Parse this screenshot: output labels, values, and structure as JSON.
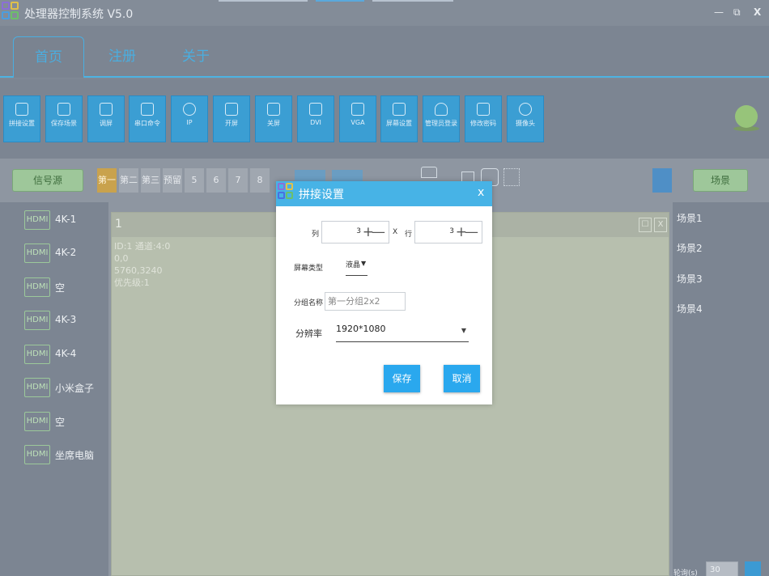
{
  "app": {
    "title": "处理器控制系统 V5.0",
    "window_controls": {
      "minimize": "—",
      "restore": "⧉",
      "close": "X"
    }
  },
  "tabs": [
    {
      "label": "首页",
      "active": true
    },
    {
      "label": "注册",
      "active": false
    },
    {
      "label": "关于",
      "active": false
    }
  ],
  "toolbar": [
    {
      "label": "拼接设置",
      "icon": "monitor-icon"
    },
    {
      "label": "保存场景",
      "icon": "save-icon"
    },
    {
      "label": "调屏",
      "icon": "adjust-icon"
    },
    {
      "label": "串口命令",
      "icon": "serial-icon"
    },
    {
      "label": "IP",
      "icon": "location-icon"
    },
    {
      "label": "开屏",
      "icon": "screen-on-icon"
    },
    {
      "label": "关屏",
      "icon": "screen-off-icon"
    },
    {
      "label": "DVI",
      "icon": "dvi-icon"
    },
    {
      "label": "VGA",
      "icon": "vga-icon"
    },
    {
      "label": "屏幕设置",
      "icon": "screen-settings-icon"
    },
    {
      "label": "管理员登录",
      "icon": "user-icon"
    },
    {
      "label": "修改密码",
      "icon": "lock-icon"
    },
    {
      "label": "摄像头",
      "icon": "camera-icon"
    }
  ],
  "buttonbar": {
    "signal_source": "信号源",
    "scene_button": "场景",
    "pages": [
      "第一",
      "第二",
      "第三",
      "预留",
      "5",
      "6",
      "7",
      "8"
    ],
    "active_page": 0
  },
  "signals": [
    {
      "badge": "HDMI",
      "name": "4K-1"
    },
    {
      "badge": "HDMI",
      "name": "4K-2"
    },
    {
      "badge": "HDMI",
      "name": "空"
    },
    {
      "badge": "HDMI",
      "name": "4K-3"
    },
    {
      "badge": "HDMI",
      "name": "4K-4"
    },
    {
      "badge": "HDMI",
      "name": "小米盒子"
    },
    {
      "badge": "HDMI",
      "name": "空"
    },
    {
      "badge": "HDMI",
      "name": "坐席电脑"
    }
  ],
  "canvas": {
    "window_number": "1",
    "info_line1": "ID:1  通道:4:0",
    "info_line2": "0,0",
    "info_line3": "5760,3240",
    "info_line4": "优先级:1",
    "btn_maximize": "☐",
    "btn_close": "X"
  },
  "scenes": [
    "场景1",
    "场景2",
    "场景3",
    "场景4"
  ],
  "interval": {
    "label": "轮询(s)",
    "value": "30"
  },
  "dialog": {
    "title": "拼接设置",
    "close": "x",
    "cols_label": "列",
    "cols_value": "3",
    "x_label": "X",
    "rows_label": "行",
    "rows_value": "3",
    "plus": "+",
    "minus": "—",
    "screen_type_label": "屏幕类型",
    "screen_type_value": "液晶",
    "group_name_label": "分组名称",
    "group_name_placeholder": "第一分组2x2",
    "resolution_label": "分辨率",
    "resolution_value": "1920*1080",
    "save": "保存",
    "cancel": "取消"
  },
  "colors": {
    "accent": "#47b3e6",
    "tool_blue": "#3b9ed3",
    "green": "#9ec79a",
    "page_active": "#c9a24d"
  }
}
